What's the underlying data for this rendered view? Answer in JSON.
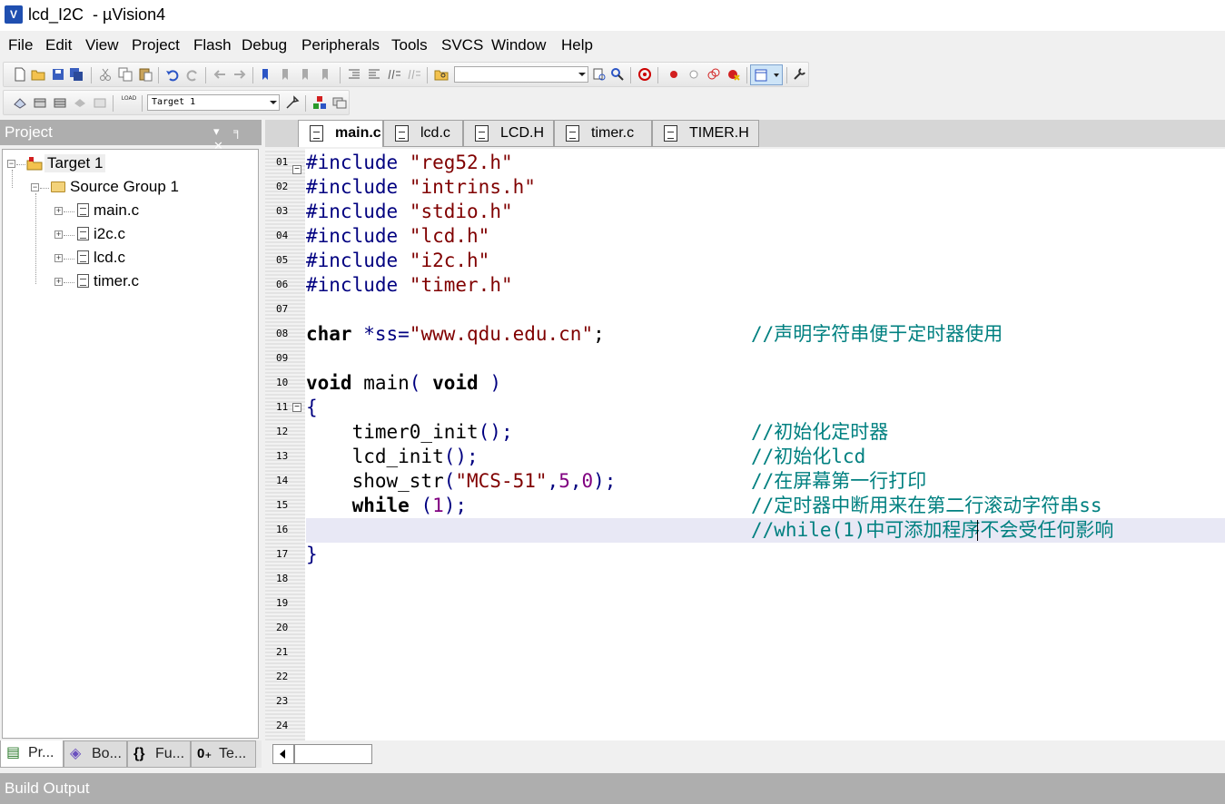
{
  "window": {
    "title": "lcd_I2C  - µVision4",
    "app_icon_label": "V"
  },
  "menu": [
    "File",
    "Edit",
    "View",
    "Project",
    "Flash",
    "Debug",
    "Peripherals",
    "Tools",
    "SVCS",
    "Window",
    "Help"
  ],
  "toolbar": {
    "find_combo_value": "",
    "target_combo_value": "Target 1",
    "load_label": "LOAD"
  },
  "project_panel": {
    "header": "Project",
    "controls": "▾ ╕ ✕",
    "tree": {
      "target": "Target 1",
      "group": "Source Group 1",
      "files": [
        "main.c",
        "i2c.c",
        "lcd.c",
        "timer.c"
      ]
    },
    "tabs": [
      "Pr...",
      "Bo...",
      "Fu...",
      "Te..."
    ],
    "tab_glyphs": [
      "▤",
      "◈",
      "{}",
      "0₊"
    ]
  },
  "editor": {
    "tabs": [
      "main.c",
      "lcd.c",
      "LCD.H",
      "timer.c",
      "TIMER.H"
    ],
    "active_tab": "main.c",
    "line_numbers": [
      "01",
      "02",
      "03",
      "04",
      "05",
      "06",
      "07",
      "08",
      "09",
      "10",
      "11",
      "12",
      "13",
      "14",
      "15",
      "16",
      "17",
      "18",
      "19",
      "20",
      "21",
      "22",
      "23",
      "24"
    ],
    "code": {
      "l01_dir": "#include",
      "l01_str": "\"reg52.h\"",
      "l02_dir": "#include",
      "l02_str": "\"intrins.h\"",
      "l03_dir": "#include",
      "l03_str": "\"stdio.h\"",
      "l04_dir": "#include",
      "l04_str": "\"lcd.h\"",
      "l05_dir": "#include",
      "l05_str": "\"i2c.h\"",
      "l06_dir": "#include",
      "l06_str": "\"timer.h\"",
      "l08_kw": "char",
      "l08_mid": " *ss=",
      "l08_str": "\"www.qdu.edu.cn\"",
      "l08_end": ";",
      "l08_cmt": "//声明字符串便于定时器使用",
      "l10_kw1": "void",
      "l10_mid": " main",
      "l10_p1": "( ",
      "l10_kw2": "void",
      "l10_p2": " )",
      "l11_brace": "{",
      "l12_code": "    timer0_init",
      "l12_punc": "();",
      "l12_cmt": "//初始化定时器",
      "l13_code": "    lcd_init",
      "l13_punc": "();",
      "l13_cmt": "//初始化lcd",
      "l14_code": "    show_str",
      "l14_p1": "(",
      "l14_str": "\"MCS-51\"",
      "l14_c1": ",",
      "l14_n1": "5",
      "l14_c2": ",",
      "l14_n2": "0",
      "l14_p2": ");",
      "l14_cmt": "//在屏幕第一行打印",
      "l15_kw": "while",
      "l15_p1": " (",
      "l15_n": "1",
      "l15_p2": ");",
      "l15_cmt": "//定时器中断用来在第二行滚动字符串ss",
      "l16_cmt": "//while(1)中可添加程序不会受任何影响",
      "l17_brace": "}"
    }
  },
  "build_output": {
    "header": "Build Output"
  }
}
